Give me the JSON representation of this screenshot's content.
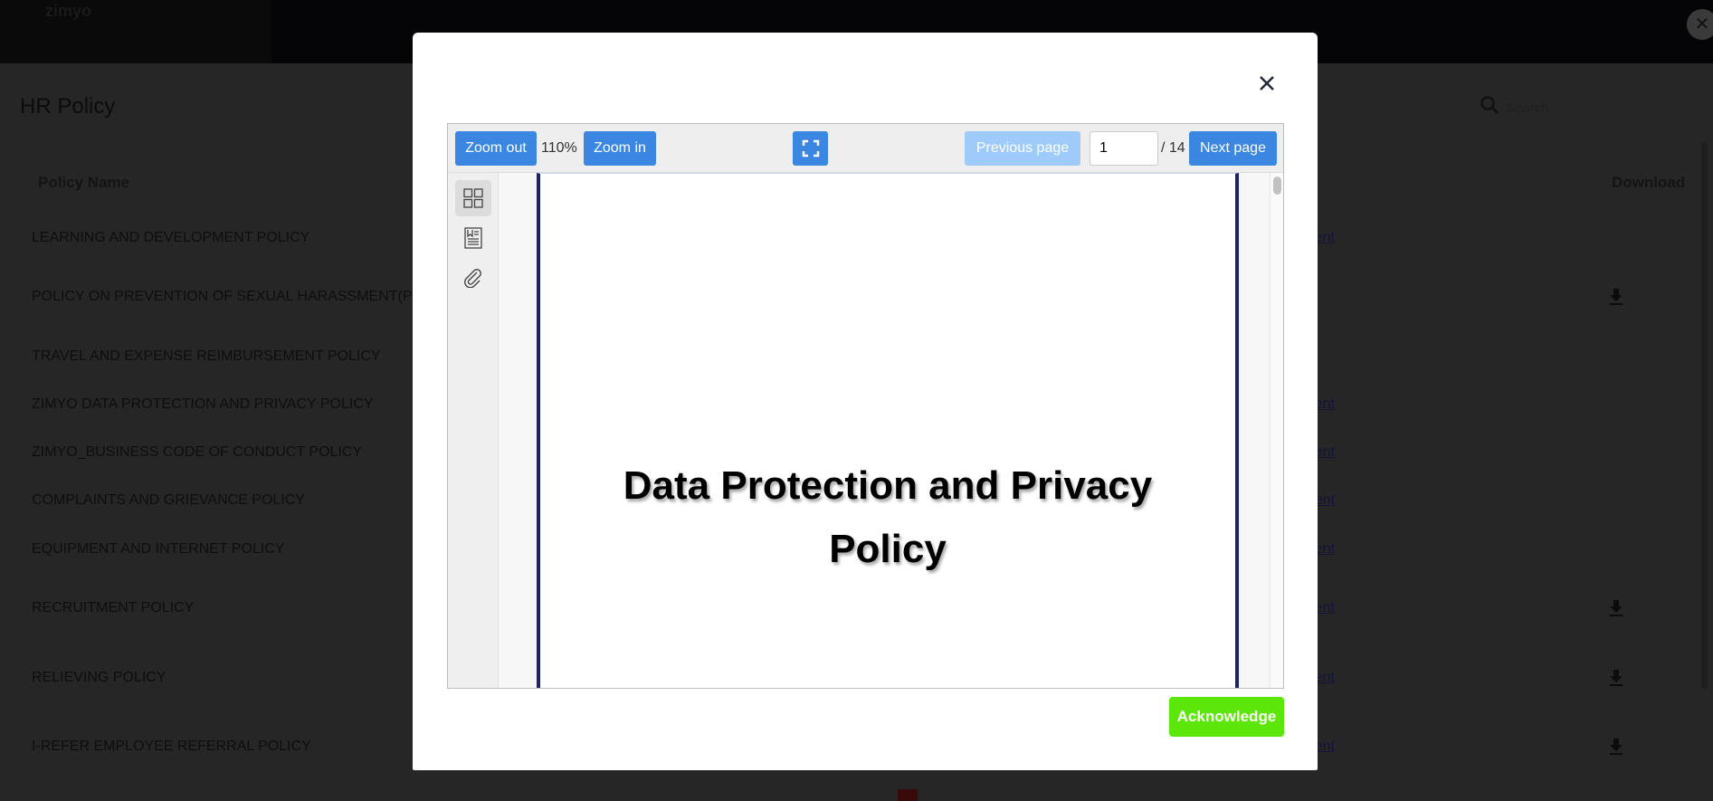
{
  "app": {
    "logo": "zimyo"
  },
  "page": {
    "title": "HR Policy",
    "search_placeholder": "Search"
  },
  "table": {
    "headers": {
      "name": "Policy Name",
      "download": "Download"
    },
    "link_label": "View Document",
    "rows": [
      {
        "name": "LEARNING AND DEVELOPMENT POLICY",
        "link": true,
        "download": false
      },
      {
        "name": "POLICY ON PREVENTION OF SEXUAL HARASSMENT(POSH)",
        "link": false,
        "download": true
      },
      {
        "name": "TRAVEL AND EXPENSE REIMBURSEMENT POLICY",
        "link": false,
        "download": false
      },
      {
        "name": "ZIMYO DATA PROTECTION AND PRIVACY POLICY",
        "link": true,
        "download": false
      },
      {
        "name": "ZIMYO_BUSINESS CODE OF CONDUCT POLICY",
        "link": true,
        "download": false
      },
      {
        "name": "COMPLAINTS AND GRIEVANCE POLICY",
        "link": true,
        "download": false
      },
      {
        "name": "EQUIPMENT AND INTERNET POLICY",
        "link": true,
        "download": false
      },
      {
        "name": "RECRUITMENT POLICY",
        "link": true,
        "download": true
      },
      {
        "name": "RELIEVING POLICY",
        "link": true,
        "download": true
      },
      {
        "name": "I-REFER EMPLOYEE REFERRAL POLICY",
        "link": true,
        "download": true
      }
    ]
  },
  "viewer": {
    "zoom_out": "Zoom out",
    "zoom_level": "110%",
    "zoom_in": "Zoom in",
    "previous_page": "Previous page",
    "current_page": "1",
    "total_pages": "/ 14",
    "next_page": "Next page",
    "sidebar_icons": [
      "thumbnails-icon",
      "bookmarks-icon",
      "attachments-icon"
    ],
    "document_title_line1": "Data Protection and Privacy",
    "document_title_line2": "Policy"
  },
  "modal": {
    "acknowledge": "Acknowledge"
  },
  "colors": {
    "primary": "#3a86e0",
    "disabled": "#9ecbfa",
    "acknowledge": "#5ce60a",
    "page_border": "#1b2466"
  }
}
